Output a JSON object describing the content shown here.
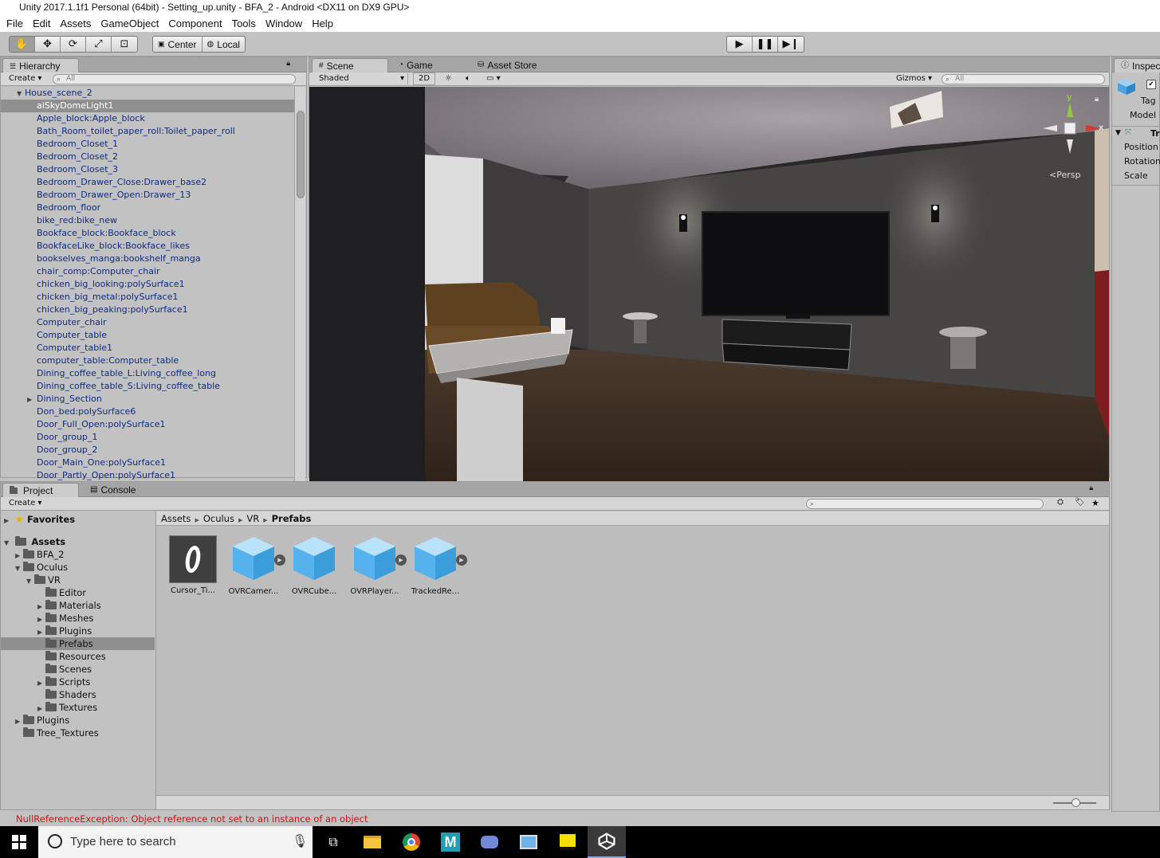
{
  "window": {
    "title": "Unity 2017.1.1f1 Personal (64bit) - Setting_up.unity - BFA_2 - Android <DX11 on DX9 GPU>"
  },
  "menu": [
    "File",
    "Edit",
    "Assets",
    "GameObject",
    "Component",
    "Tools",
    "Window",
    "Help"
  ],
  "toolbar": {
    "pivot_label": "Center",
    "space_label": "Local"
  },
  "hierarchy": {
    "tab": "Hierarchy",
    "create": "Create",
    "search_placeholder": "All",
    "root": "House_scene_2",
    "items": [
      "aiSkyDomeLight1",
      "Apple_block:Apple_block",
      "Bath_Room_toilet_paper_roll:Toilet_paper_roll",
      "Bedroom_Closet_1",
      "Bedroom_Closet_2",
      "Bedroom_Closet_3",
      "Bedroom_Drawer_Close:Drawer_base2",
      "Bedroom_Drawer_Open:Drawer_13",
      "Bedroom_floor",
      "bike_red:bike_new",
      "Bookface_block:Bookface_block",
      "BookfaceLike_block:Bookface_likes",
      "bookselves_manga:bookshelf_manga",
      "chair_comp:Computer_chair",
      "chicken_big_looking:polySurface1",
      "chicken_big_metal:polySurface1",
      "chicken_big_peaking:polySurface1",
      "Computer_chair",
      "Computer_table",
      "Computer_table1",
      "computer_table:Computer_table",
      "Dining_coffee_table_L:Living_coffee_long",
      "Dining_coffee_table_S:Living_coffee_table",
      "Dining_Section",
      "Don_bed:polySurface6",
      "Door_Full_Open:polySurface1",
      "Door_group_1",
      "Door_group_2",
      "Door_Main_One:polySurface1",
      "Door_Partly_Open:polySurface1"
    ]
  },
  "scene": {
    "tabs": [
      "Scene",
      "Game",
      "Asset Store"
    ],
    "shading": "Shaded",
    "mode_2d": "2D",
    "gizmos": "Gizmos",
    "search_placeholder": "All",
    "persp": "Persp",
    "axis_y": "y",
    "axis_x": "x"
  },
  "inspector": {
    "tab": "Inspec",
    "tag_label": "Tag",
    "model_label": "Model",
    "transform_label": "Tr",
    "position": "Position",
    "rotation": "Rotation",
    "scale": "Scale"
  },
  "project": {
    "tabs": [
      "Project",
      "Console"
    ],
    "create": "Create",
    "favorites": "Favorites",
    "assets_root": "Assets",
    "tree": [
      {
        "label": "BFA_2",
        "depth": 1,
        "arrow": "right"
      },
      {
        "label": "Oculus",
        "depth": 1,
        "arrow": "down"
      },
      {
        "label": "VR",
        "depth": 2,
        "arrow": "down"
      },
      {
        "label": "Editor",
        "depth": 3,
        "arrow": ""
      },
      {
        "label": "Materials",
        "depth": 3,
        "arrow": "right"
      },
      {
        "label": "Meshes",
        "depth": 3,
        "arrow": "right"
      },
      {
        "label": "Plugins",
        "depth": 3,
        "arrow": "right"
      },
      {
        "label": "Prefabs",
        "depth": 3,
        "arrow": "",
        "selected": true
      },
      {
        "label": "Resources",
        "depth": 3,
        "arrow": ""
      },
      {
        "label": "Scenes",
        "depth": 3,
        "arrow": ""
      },
      {
        "label": "Scripts",
        "depth": 3,
        "arrow": "right"
      },
      {
        "label": "Shaders",
        "depth": 3,
        "arrow": ""
      },
      {
        "label": "Textures",
        "depth": 3,
        "arrow": "right"
      },
      {
        "label": "Plugins",
        "depth": 1,
        "arrow": "right"
      },
      {
        "label": "Tree_Textures",
        "depth": 1,
        "arrow": ""
      }
    ],
    "breadcrumb": [
      "Assets",
      "Oculus",
      "VR",
      "Prefabs"
    ],
    "assets": [
      {
        "label": "Cursor_Ti...",
        "kind": "texture"
      },
      {
        "label": "OVRCamer...",
        "kind": "prefab-play"
      },
      {
        "label": "OVRCube...",
        "kind": "prefab"
      },
      {
        "label": "OVRPlayer...",
        "kind": "prefab-play"
      },
      {
        "label": "TrackedRe...",
        "kind": "prefab-play"
      }
    ]
  },
  "status": {
    "message": "NullReferenceException: Object reference not set to an instance of an object"
  },
  "taskbar": {
    "search_placeholder": "Type here to search"
  }
}
